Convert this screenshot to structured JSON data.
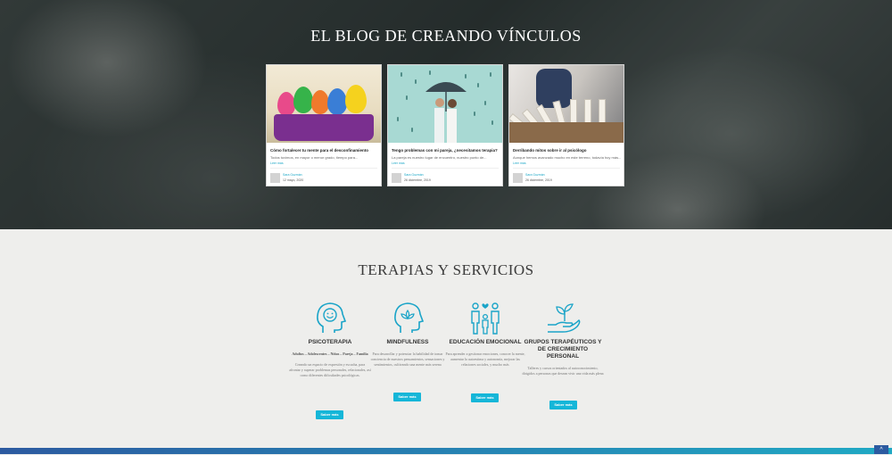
{
  "hero": {
    "title": "EL BLOG DE CREANDO VÍNCULOS"
  },
  "posts": [
    {
      "title": "Cómo fortalecer tu mente para el desconfinamiento",
      "excerpt": "Todos tuvimos, en mayor o menor grado, tiempo para...",
      "more": "Leer más",
      "author": "Sara Guzmán",
      "date": "12 mayo, 2020"
    },
    {
      "title": "Tengo problemas con mi pareja, ¿necesitamos terapia?",
      "excerpt": "La pareja es nuestro lugar de encuentro, nuestro punto de...",
      "more": "Leer más",
      "author": "Sara Guzmán",
      "date": "26 diciembre, 2019"
    },
    {
      "title": "Derribando mitos sobre ir al psicólogo",
      "excerpt": "Aunque hemos avanzado mucho en este terreno, todavía hoy más...",
      "more": "Leer más",
      "author": "Sara Guzmán",
      "date": "26 diciembre, 2019"
    }
  ],
  "services": {
    "title": "TERAPIAS Y SERVICIOS",
    "items": [
      {
        "name": "PSICOTERAPIA",
        "sub": "Adultos – Adolescentes – Niños – Pareja – Familia",
        "desc": "Creando un espacio de expresión y escucha, para afrontar y superar problemas personales, relacionales, así como diferentes dificultades psicológicas.",
        "button": "Saber más",
        "icon": "head-smile-icon"
      },
      {
        "name": "MINDFULNESS",
        "sub": "",
        "desc": "Para desarrollar y potenciar la habilidad de tomar conciencia de nuestros pensamientos, sensaciones y sentimientos, cultivando una mente más serena",
        "button": "Saber más",
        "icon": "head-lotus-icon"
      },
      {
        "name": "EDUCACIÓN EMOCIONAL",
        "sub": "",
        "desc": "Para aprender a gestionar emociones, conocer la mente, aumentar la autoestima y autonomía, mejorar las relaciones sociales, y mucho más",
        "button": "Saber más",
        "icon": "family-icon"
      },
      {
        "name": "GRUPOS TERAPÉUTICOS Y DE CRECIMIENTO PERSONAL",
        "sub": "",
        "desc": "Talleres y cursos orientados al autoconocimiento, dirigidos a personas que desean vivir una vida más plena",
        "button": "Saber más",
        "icon": "hand-sprout-icon"
      }
    ]
  },
  "colors": {
    "accent": "#15b6d8",
    "icon": "#1aa4c8",
    "footer": "#2c5aa0"
  },
  "footer": {
    "to_top_icon": "chevron-up-icon"
  }
}
